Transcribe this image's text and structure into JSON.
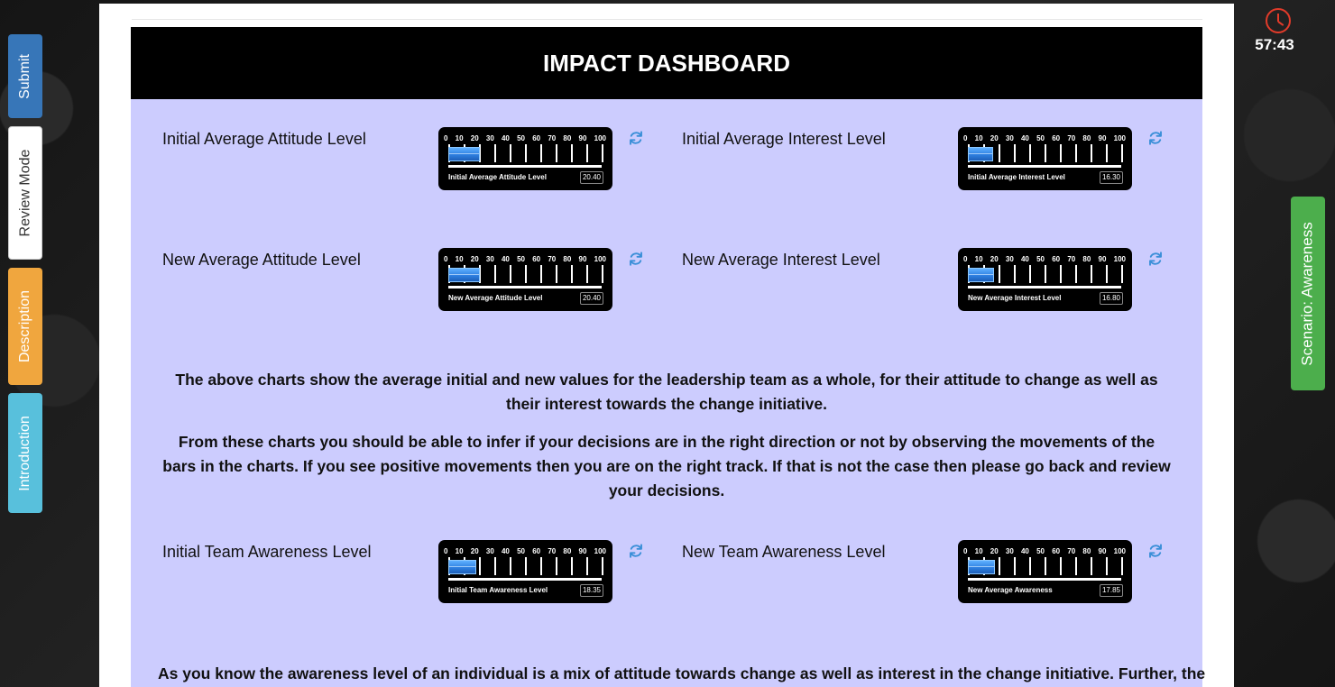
{
  "sidebar": {
    "tabs": [
      {
        "label": "Submit"
      },
      {
        "label": "Review Mode"
      },
      {
        "label": "Description"
      },
      {
        "label": "Introduction"
      }
    ]
  },
  "scenario_tab": {
    "label": "Scenario: Awareness"
  },
  "timer": {
    "value": "57:43"
  },
  "dashboard": {
    "title": "IMPACT DASHBOARD",
    "scale_labels": [
      "0",
      "10",
      "20",
      "30",
      "40",
      "50",
      "60",
      "70",
      "80",
      "90",
      "100"
    ],
    "metrics": [
      {
        "label": "Initial Average Attitude Level",
        "gauge_caption": "Initial Average Attitude Level",
        "value_text": "20.40",
        "level": 20.4
      },
      {
        "label": "Initial Average Interest Level",
        "gauge_caption": "Initial Average Interest Level",
        "value_text": "16.30",
        "level": 16.3
      },
      {
        "label": "New Average Attitude Level",
        "gauge_caption": "New Average Attitude Level",
        "value_text": "20.40",
        "level": 20.4
      },
      {
        "label": "New Average Interest Level",
        "gauge_caption": "New Average Interest Level",
        "value_text": "16.80",
        "level": 16.8
      },
      {
        "label": "Initial Team Awareness Level",
        "gauge_caption": "Initial Team Awareness Level",
        "value_text": "18.35",
        "level": 18.35
      },
      {
        "label": "New Team Awareness Level",
        "gauge_caption": "New Average Awareness",
        "value_text": "17.85",
        "level": 17.85
      }
    ],
    "paragraphs": [
      "The above charts show the average initial and new values for the leadership team as a whole, for their attitude to change as well as their interest towards the change initiative.",
      "From these charts you should be able to infer if your decisions are in the right direction or not by observing the movements of the bars in the charts. If you see positive movements then you are on the right track. If that is not the case then please go back and review your decisions.",
      "As you know the awareness level of an individual is a mix of attitude towards change as well as interest in the change initiative. Further, the"
    ]
  },
  "colors": {
    "header_bg": "#000000",
    "content_bg": "#ccccfe",
    "submit_tab": "#3776b8",
    "description_tab": "#f0a63e",
    "introduction_tab": "#58c0dc",
    "scenario_tab": "#4cae4c",
    "gauge_fill": "#2e7fe0",
    "refresh_icon": "#3a8fd8",
    "timer_icon": "#e23b2a"
  }
}
